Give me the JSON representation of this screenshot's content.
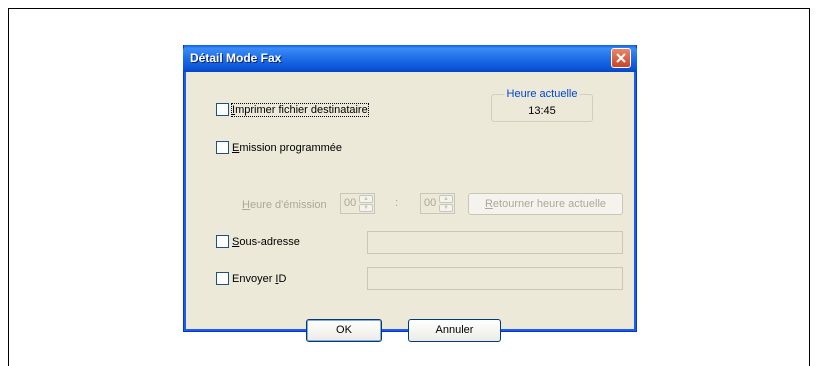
{
  "dialog": {
    "title": "Détail Mode Fax",
    "clock": {
      "label": "Heure actuelle",
      "time": "13:45"
    },
    "print_dest": {
      "label_u": "I",
      "label_rest": "mprimer fichier destinataire",
      "checked": false
    },
    "schedule": {
      "label_u": "E",
      "label_rest": "mission programmée",
      "checked": false,
      "time_label_u": "H",
      "time_label_rest": "eure d'émission",
      "hours": "00",
      "colon": ":",
      "minutes": "00",
      "reset_u": "R",
      "reset_rest": "etourner heure actuelle"
    },
    "subaddress": {
      "label_u": "S",
      "label_rest": "ous-adresse",
      "checked": false,
      "value": ""
    },
    "send_id": {
      "label_pre": "Envoyer ",
      "label_u": "I",
      "label_rest": "D",
      "checked": false,
      "value": ""
    },
    "ok_label": "OK",
    "cancel_label": "Annuler"
  }
}
